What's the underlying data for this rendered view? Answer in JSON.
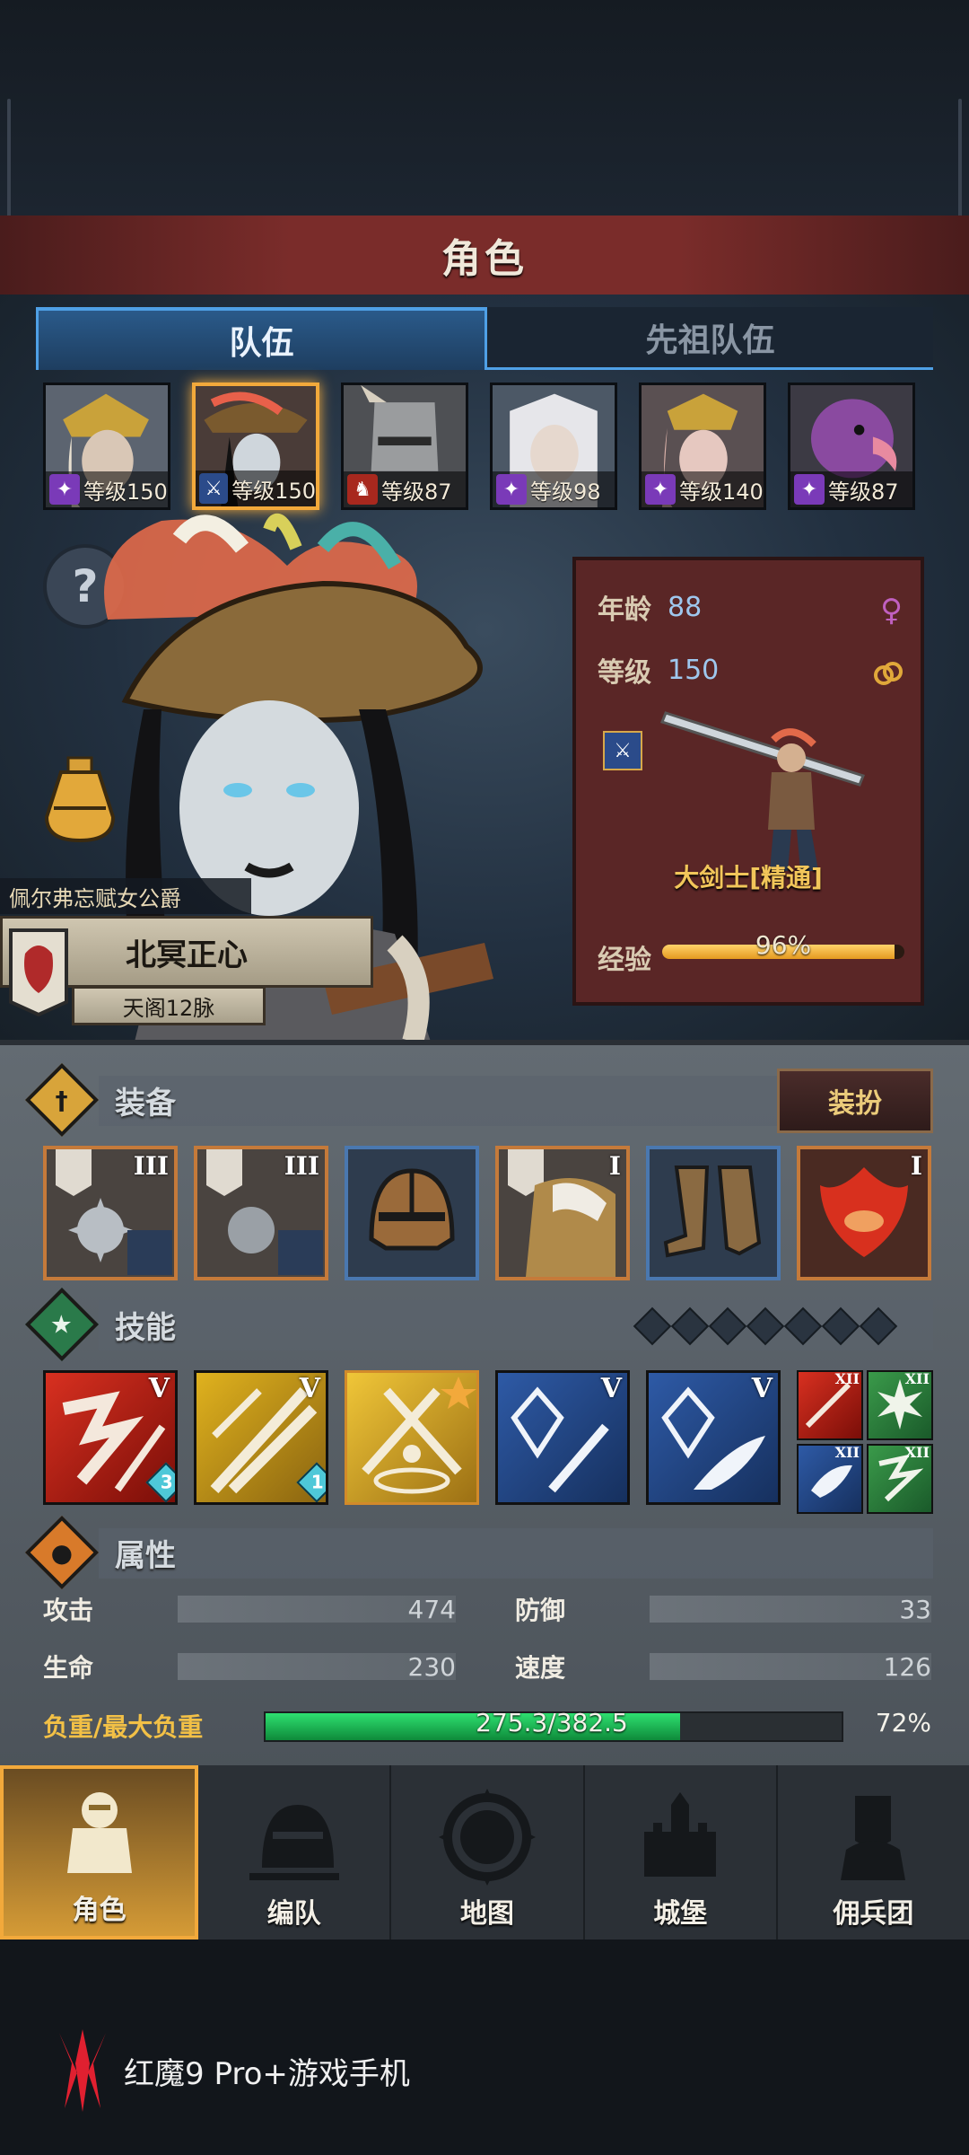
{
  "screen": {
    "title": "角色"
  },
  "tabs": [
    {
      "label": "队伍",
      "active": true
    },
    {
      "label": "先祖队伍",
      "active": false
    }
  ],
  "party": [
    {
      "level": "等级150",
      "selected": false,
      "class_color": "#7a3ab8"
    },
    {
      "level": "等级150",
      "selected": true,
      "class_color": "#2b4b8a"
    },
    {
      "level": "等级87",
      "selected": false,
      "class_color": "#a8281e"
    },
    {
      "level": "等级98",
      "selected": false,
      "class_color": "#7a3ab8"
    },
    {
      "level": "等级140",
      "selected": false,
      "class_color": "#7a3ab8"
    },
    {
      "level": "等级87",
      "selected": false,
      "class_color": "#7a3ab8"
    }
  ],
  "hero": {
    "epithet": "佩尔弗忘赋女公爵",
    "name": "北冥正心",
    "lineage": "天阁12脉"
  },
  "stats_card": {
    "age_label": "年龄",
    "age_value": "88",
    "level_label": "等级",
    "level_value": "150",
    "class_name": "大剑士[精通]",
    "exp_label": "经验",
    "exp_percent_text": "96%",
    "exp_fraction": 0.96
  },
  "equipment": {
    "title": "装备",
    "outfit_button": "装扮",
    "slots": [
      {
        "tier": "III",
        "rarity": "orange"
      },
      {
        "tier": "III",
        "rarity": "orange"
      },
      {
        "tier": "",
        "rarity": "blue"
      },
      {
        "tier": "I",
        "rarity": "orange"
      },
      {
        "tier": "",
        "rarity": "blue"
      },
      {
        "tier": "I",
        "rarity": "orange"
      }
    ]
  },
  "skills": {
    "title": "技能",
    "items": [
      {
        "tier": "V",
        "badge": "3",
        "color": "red"
      },
      {
        "tier": "V",
        "badge": "1",
        "color": "gold"
      },
      {
        "tier": "",
        "badge": "",
        "color": "gold2"
      },
      {
        "tier": "V",
        "badge": "",
        "color": "blue"
      },
      {
        "tier": "V",
        "badge": "",
        "color": "blue"
      }
    ],
    "passives": [
      "XII",
      "XII",
      "XII",
      "XII"
    ]
  },
  "attributes": {
    "title": "属性",
    "attack_label": "攻击",
    "attack_value": "474",
    "defense_label": "防御",
    "defense_value": "33",
    "hp_label": "生命",
    "hp_value": "230",
    "speed_label": "速度",
    "speed_value": "126",
    "load_label": "负重/最大负重",
    "load_text": "275.3/382.5",
    "load_percent": "72%",
    "load_fraction": 0.72
  },
  "nav": [
    {
      "label": "角色",
      "active": true,
      "icon": "knight-icon"
    },
    {
      "label": "编队",
      "active": false,
      "icon": "helmet-icon"
    },
    {
      "label": "地图",
      "active": false,
      "icon": "compass-map-icon"
    },
    {
      "label": "城堡",
      "active": false,
      "icon": "castle-icon"
    },
    {
      "label": "佣兵团",
      "active": false,
      "icon": "banner-fist-icon"
    }
  ],
  "watermark": {
    "text": "红魔9 Pro+游戏手机"
  }
}
